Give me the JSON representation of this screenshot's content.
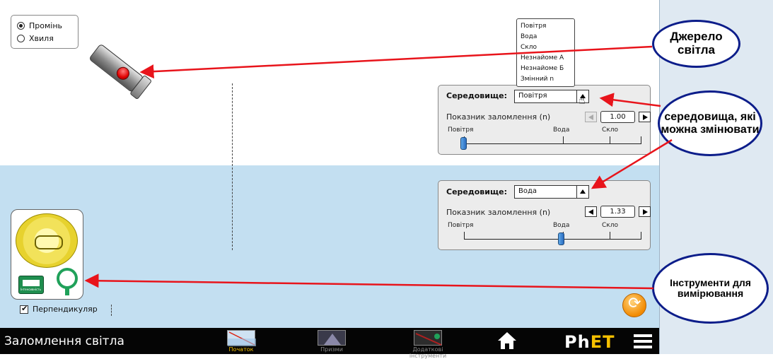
{
  "app": {
    "title": "Заломлення світла"
  },
  "mode": {
    "options": [
      "Промінь",
      "Хвиля"
    ],
    "selected": "Промінь"
  },
  "top_medium": {
    "label": "Середовище:",
    "selected": "Повітря",
    "ri_label": "Показник заломлення (n)",
    "ri_value": "1.00",
    "slider_labels": [
      "Повітря",
      "Вода",
      "Скло"
    ],
    "slider_position": 0.0
  },
  "dropdown": {
    "options": [
      "Повітря",
      "Вода",
      "Скло",
      "Незнайоме А",
      "Незнайоме Б",
      "Змінний n"
    ]
  },
  "bottom_medium": {
    "label": "Середовище:",
    "selected": "Вода",
    "ri_label": "Показник заломлення (n)",
    "ri_value": "1.33",
    "slider_labels": [
      "Повітря",
      "Вода",
      "Скло"
    ],
    "slider_position": 0.55
  },
  "tools": {
    "intensity_label": "Інтенсивність",
    "perpendicular_label": "Перпендикуляр",
    "perpendicular_checked": true
  },
  "nav": {
    "screens": [
      {
        "label": "Початок",
        "active": true
      },
      {
        "label": "Призми",
        "active": false
      },
      {
        "label": "Додаткові інструменти",
        "active": false
      }
    ],
    "logo": "PhET"
  },
  "callouts": {
    "light_source": "Джерело світла",
    "media": "середовища, які можна змінювати",
    "tools": "Інструменти для вимірювання"
  },
  "colors": {
    "top_medium": "#ffffff",
    "bottom_medium": "#c3dff1",
    "arrow": "#e8141b",
    "callout_border": "#0c1d8a",
    "nav_active": "#f6c000"
  },
  "icons": [
    "laser-icon",
    "protractor-icon",
    "intensity-meter-icon",
    "reset-icon",
    "home-icon",
    "menu-icon",
    "hand-cursor-icon"
  ]
}
